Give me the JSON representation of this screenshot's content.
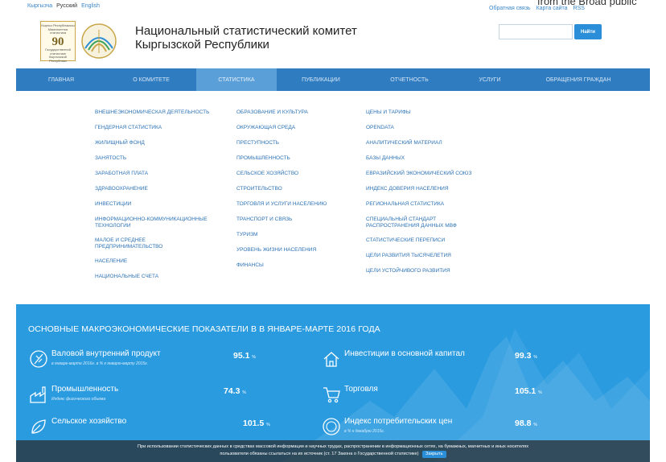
{
  "languages": [
    "Кыргызча",
    "Русский",
    "English"
  ],
  "active_language": "Русский",
  "top_links": [
    "Обратная связь",
    "Карта сайта",
    "RSS"
  ],
  "corner_text": "from the Broad public",
  "logo_badge": {
    "line1": "Кыргыз Республикасы Мамлекеттик статистика",
    "number": "90",
    "line2": "Государственной статистике Кыргызской Республики"
  },
  "site_title": {
    "line1": "Национальный статистический комитет",
    "line2": "Кыргызской Республики"
  },
  "search": {
    "button": "Найти",
    "placeholder": ""
  },
  "nav": {
    "items": [
      "ГЛАВНАЯ",
      "О КОМИТЕТЕ",
      "СТАТИСТИКА",
      "ПУБЛИКАЦИИ",
      "ОТЧЕТНОСТЬ",
      "УСЛУГИ",
      "ОБРАЩЕНИЯ ГРАЖДАН"
    ],
    "active": "СТАТИСТИКА"
  },
  "dropdown": {
    "col1": [
      "ВНЕШНЕЭКОНОМИЧЕСКАЯ ДЕЯТЕЛЬНОСТЬ",
      "ГЕНДЕРНАЯ СТАТИСТИКА",
      "ЖИЛИЩНЫЙ ФОНД",
      "ЗАНЯТОСТЬ",
      "ЗАРАБОТНАЯ ПЛАТА",
      "ЗДРАВООХРАНЕНИЕ",
      "ИНВЕСТИЦИИ",
      "ИНФОРМАЦИОННО-КОММУНИКАЦИОННЫЕ ТЕХНОЛОГИИ",
      "МАЛОЕ И СРЕДНЕЕ ПРЕДПРИНИМАТЕЛЬСТВО",
      "НАСЕЛЕНИЕ",
      "НАЦИОНАЛЬНЫЕ СЧЕТА"
    ],
    "col2": [
      "ОБРАЗОВАНИЕ И КУЛЬТУРА",
      "ОКРУЖАЮЩАЯ СРЕДА",
      "ПРЕСТУПНОСТЬ",
      "ПРОМЫШЛЕННОСТЬ",
      "СЕЛЬСКОЕ ХОЗЯЙСТВО",
      "СТРОИТЕЛЬСТВО",
      "ТОРГОВЛЯ И УСЛУГИ НАСЕЛЕНИЮ",
      "ТРАНСПОРТ И СВЯЗЬ",
      "ТУРИЗМ",
      "УРОВЕНЬ ЖИЗНИ НАСЕЛЕНИЯ",
      "ФИНАНСЫ"
    ],
    "col3": [
      "ЦЕНЫ И ТАРИФЫ",
      "OPENDATA",
      "АНАЛИТИЧЕСКИЙ МАТЕРИАЛ",
      "БАЗЫ ДАННЫХ",
      "ЕВРАЗИЙСКИЙ ЭКОНОМИЧЕСКИЙ СОЮЗ",
      "ИНДЕКС ДОВЕРИЯ НАСЕЛЕНИЯ",
      "РЕГИОНАЛЬНАЯ СТАТИСТИКА",
      "СПЕЦИАЛЬНЫЙ СТАНДАРТ РАСПРОСТРАНЕНИЯ ДАННЫХ МВФ",
      "СТАТИСТИЧЕСКИЕ ПЕРЕПИСИ",
      "ЦЕЛИ РАЗВИТИЯ ТЫСЯЧЕЛЕТИЯ",
      "ЦЕЛИ УСТОЙЧИВОГО РАЗВИТИЯ"
    ]
  },
  "macro": {
    "title": "ОСНОВНЫЕ МАКРОЭКОНОМИЧЕСКИЕ ПОКАЗАТЕЛИ В В ЯНВАРЕ-МАРТЕ 2016 ГОДА",
    "indicators": [
      {
        "name": "Валовой внутренний продукт",
        "sub": "в январе-марте 2016г. в % к январю-марту 2015г.",
        "value": "95.1",
        "unit": "%",
        "icon": "gdp-icon"
      },
      {
        "name": "Инвестиции в основной капитал",
        "sub": "",
        "value": "99.3",
        "unit": "%",
        "icon": "house-icon"
      },
      {
        "name": "Промышленность",
        "sub": "Индекс физического объема",
        "value": "74.3",
        "unit": "%",
        "icon": "factory-icon"
      },
      {
        "name": "Торговля",
        "sub": "",
        "value": "105.1",
        "unit": "%",
        "icon": "cart-icon"
      },
      {
        "name": "Сельское хозяйство",
        "sub": "",
        "value": "101.5",
        "unit": "%",
        "icon": "leaf-icon"
      },
      {
        "name": "Индекс потребительских цен",
        "sub": "в % к декабрю 2015г.",
        "value": "98.8",
        "unit": "%",
        "icon": "coin-icon"
      }
    ]
  },
  "notice": {
    "text1": "При использовании статистических данных в средствах массовой информации и научных трудах, распространении в информационных сетях, на бумажных, магнитных и иных носителях",
    "text2": "пользователи обязаны ссылаться на их источник (ст. 17 Закона о Государственной статистике)",
    "accept": "Закрыть"
  },
  "colors": {
    "nav": "#2f7cc1",
    "nav_active": "#5b9fd8",
    "macro_bg": "#2b9be0",
    "link": "#2b72b5"
  }
}
